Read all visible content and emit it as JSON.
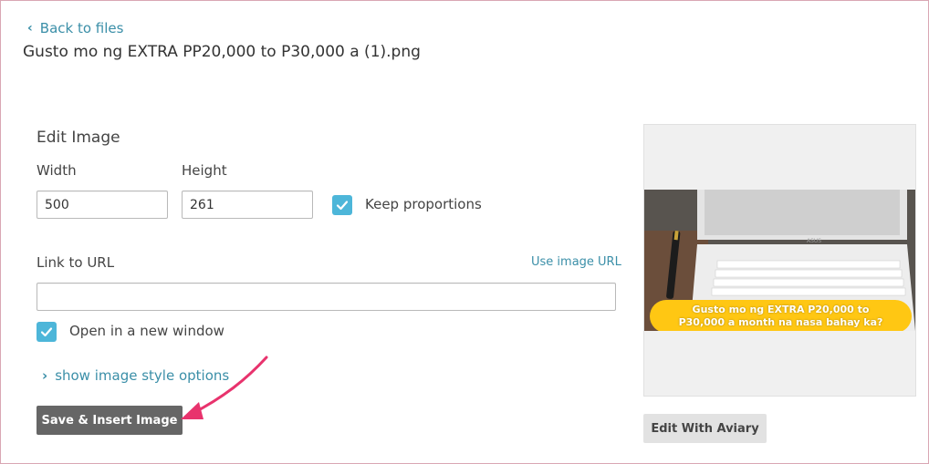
{
  "nav": {
    "back_label": "Back to files"
  },
  "file": {
    "name": "Gusto mo ng EXTRA PP20,000 to P30,000 a (1).png"
  },
  "edit": {
    "section_title": "Edit Image",
    "width_label": "Width",
    "width_value": "500",
    "height_label": "Height",
    "height_value": "261",
    "keep_proportions_label": "Keep proportions",
    "keep_proportions_checked": true,
    "link_label": "Link to URL",
    "use_image_url_label": "Use image URL",
    "link_value": "",
    "open_new_window_label": "Open in a new window",
    "open_new_window_checked": true,
    "style_options_label": "show image style options",
    "save_label": "Save & Insert Image"
  },
  "preview": {
    "laptop_brand": "ASUS",
    "caption_line1": "Gusto mo ng EXTRA P20,000 to",
    "caption_line2": "P30,000 a month na nasa bahay ka?",
    "edit_aviary_label": "Edit With Aviary"
  },
  "colors": {
    "link": "#3b8fa8",
    "checkbox": "#4db6d9",
    "save_button": "#666666",
    "arrow": "#e8336d",
    "caption_bg": "#ffc713"
  }
}
